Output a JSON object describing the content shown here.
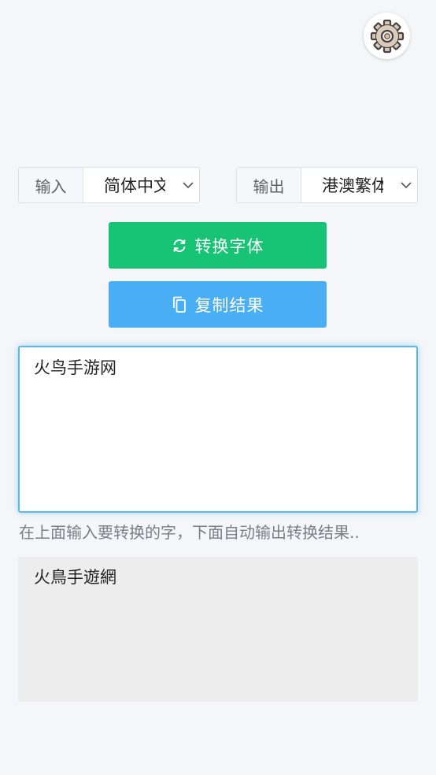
{
  "settings": {
    "icon": "gear-icon"
  },
  "input_select": {
    "label": "输入",
    "value": "简体中文"
  },
  "output_select": {
    "label": "输出",
    "value": "港澳繁体"
  },
  "buttons": {
    "convert": {
      "label": "转换字体",
      "icon": "refresh-icon",
      "color": "#17c375"
    },
    "copy": {
      "label": "复制结果",
      "icon": "copy-icon",
      "color": "#4aaef5"
    }
  },
  "input_text": "火鸟手游网",
  "hint": "在上面输入要转换的字，下面自动输出转换结果..",
  "output_text": "火鳥手遊網",
  "colors": {
    "background": "#f4f6f9",
    "input_border": "#5cb8ea",
    "output_bg": "#ededed"
  }
}
